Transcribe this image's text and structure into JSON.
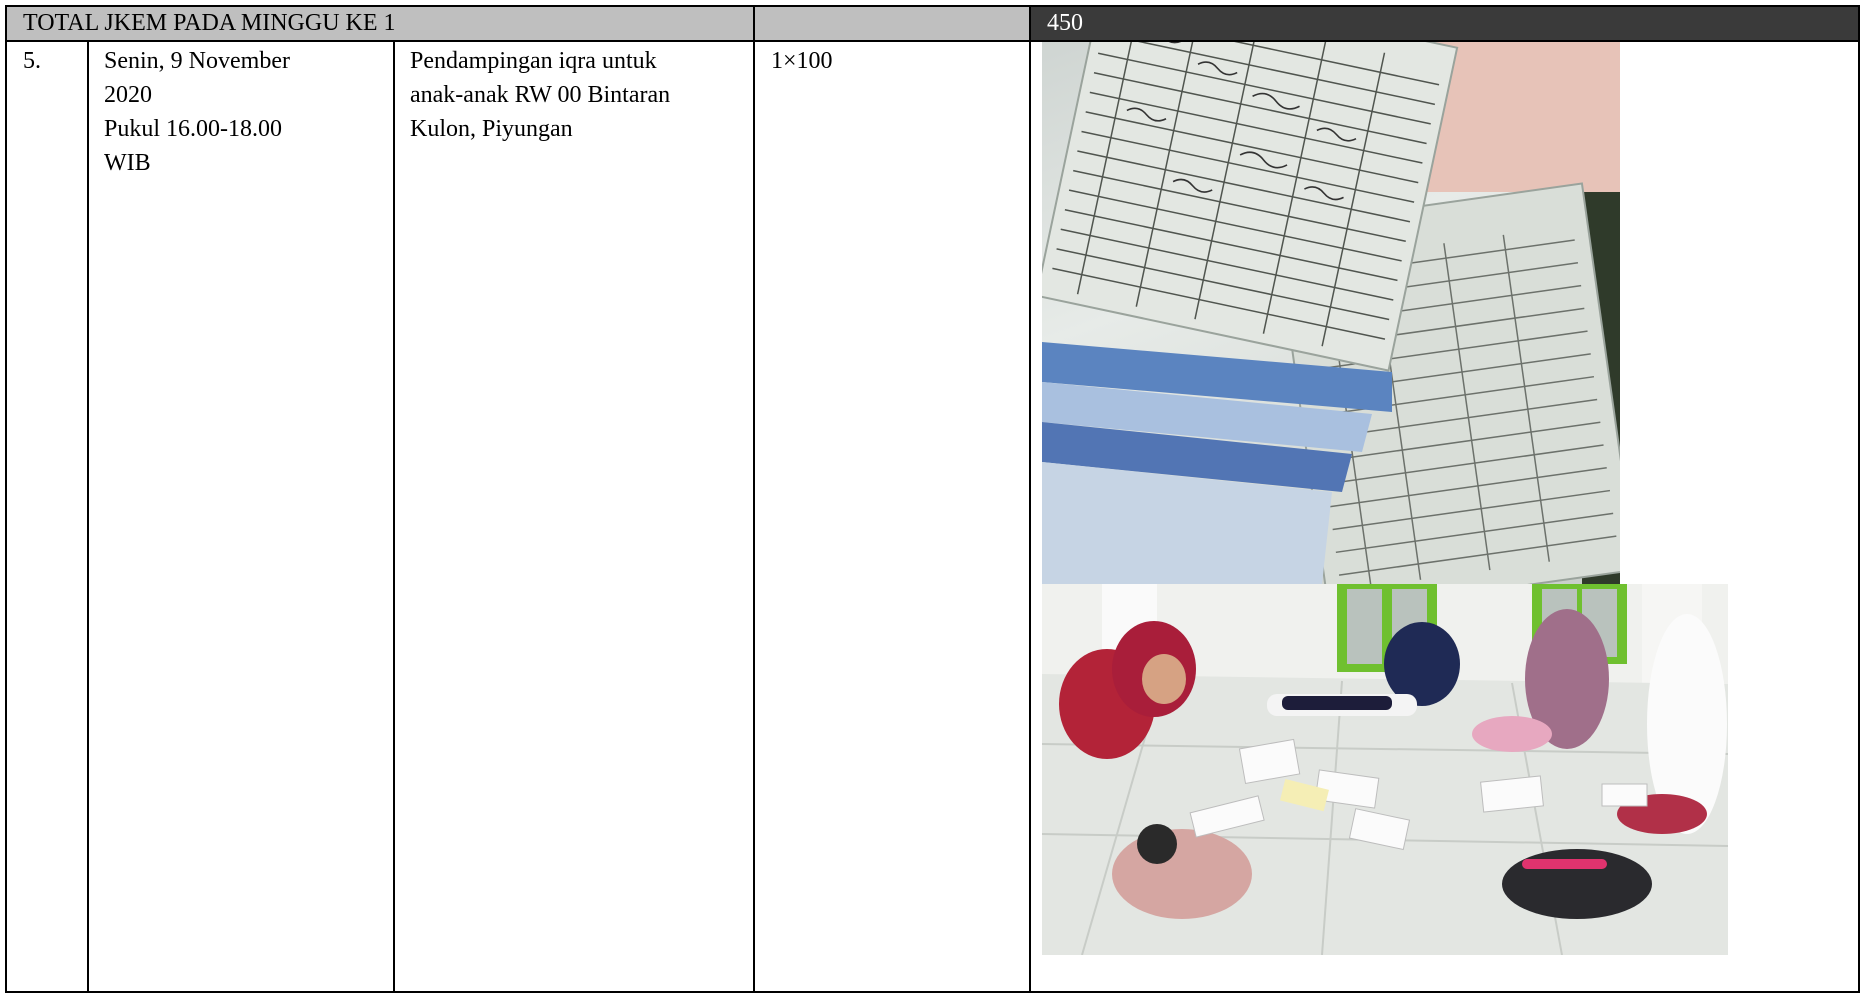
{
  "table": {
    "header": {
      "label": "TOTAL JKEM PADA MINGGU KE 1",
      "total": "450"
    },
    "row": {
      "number": "5.",
      "date_lines": [
        "Senin, 9 November",
        "2020",
        "Pukul 16.00-18.00",
        "WIB"
      ],
      "activity_lines": [
        "Pendampingan iqra untuk",
        "anak-anak RW 00 Bintaran",
        "Kulon, Piyungan"
      ],
      "jkem": "1×100"
    }
  },
  "photos": [
    {
      "name": "attendance-sheets-photo"
    },
    {
      "name": "children-studying-photo"
    }
  ]
}
